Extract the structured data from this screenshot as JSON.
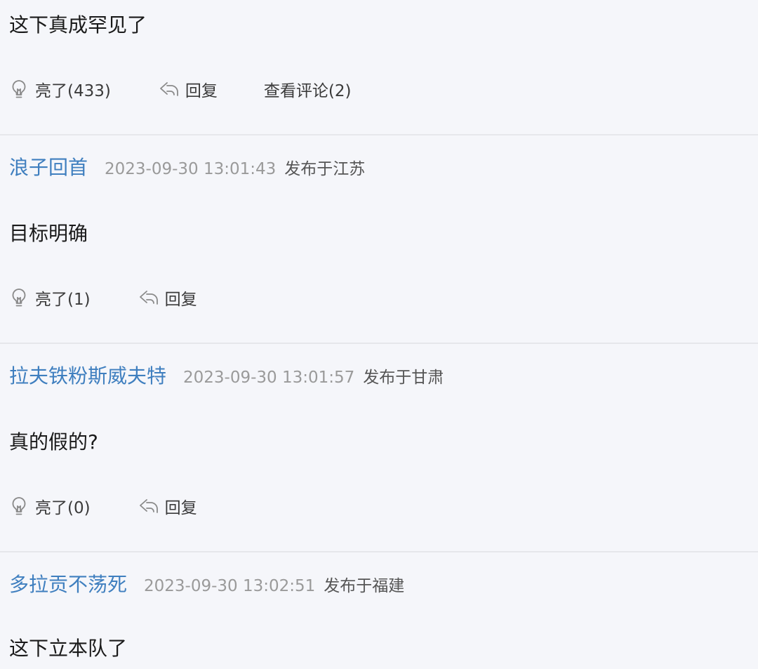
{
  "comments": [
    {
      "body": "这下真成罕见了",
      "like_label": "亮了(433)",
      "reply_label": "回复",
      "view_comments_label": "查看评论(2)"
    },
    {
      "username": "浪子回首",
      "timestamp": "2023-09-30 13:01:43",
      "location": "发布于江苏",
      "body": "目标明确",
      "like_label": "亮了(1)",
      "reply_label": "回复"
    },
    {
      "username": "拉夫铁粉斯威夫特",
      "timestamp": "2023-09-30 13:01:57",
      "location": "发布于甘肃",
      "body": "真的假的?",
      "like_label": "亮了(0)",
      "reply_label": "回复"
    },
    {
      "username": "多拉贡不荡死",
      "timestamp": "2023-09-30 13:02:51",
      "location": "发布于福建",
      "body": "这下立本队了"
    }
  ],
  "colors": {
    "background": "#f5f6fa",
    "username": "#3f7fbf",
    "timestamp": "#9a9a9a",
    "divider": "#e6e7eb"
  },
  "icons": {
    "like": "lightbulb-icon",
    "reply": "reply-arrow-icon"
  }
}
